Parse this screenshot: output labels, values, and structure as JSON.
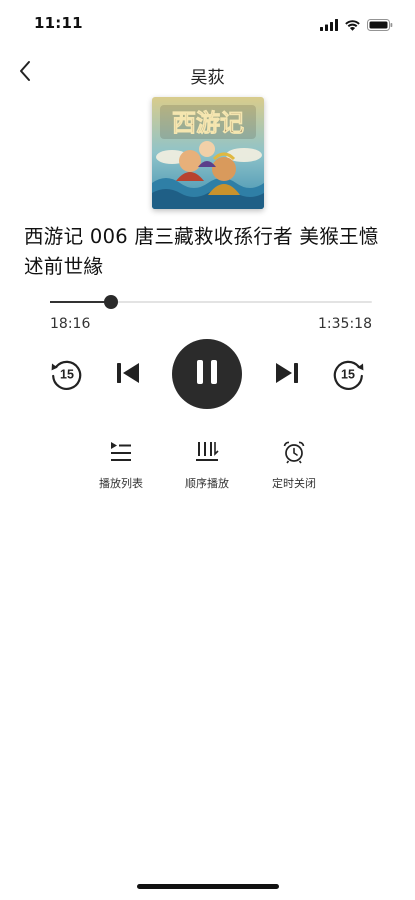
{
  "status_bar": {
    "time": "11:11",
    "icons": [
      "signal-icon",
      "wifi-icon",
      "battery-icon"
    ]
  },
  "header": {
    "title": "吴荻",
    "back_icon": "chevron-left-icon"
  },
  "cover": {
    "title_art": "西游记"
  },
  "track": {
    "title": "西游记 006 唐三藏救收孫行者 美猴王憶述前世緣"
  },
  "progress": {
    "elapsed": "18:16",
    "total": "1:35:18",
    "fraction": 0.19
  },
  "controls": {
    "rewind_seconds": "15",
    "forward_seconds": "15",
    "state": "playing"
  },
  "tools": [
    {
      "label": "播放列表",
      "icon": "playlist-icon"
    },
    {
      "label": "顺序播放",
      "icon": "sequential-play-icon"
    },
    {
      "label": "定时关闭",
      "icon": "alarm-clock-icon"
    }
  ],
  "colors": {
    "primary": "#2b2b2b",
    "track": "#e3e3e3",
    "background": "#ffffff"
  }
}
